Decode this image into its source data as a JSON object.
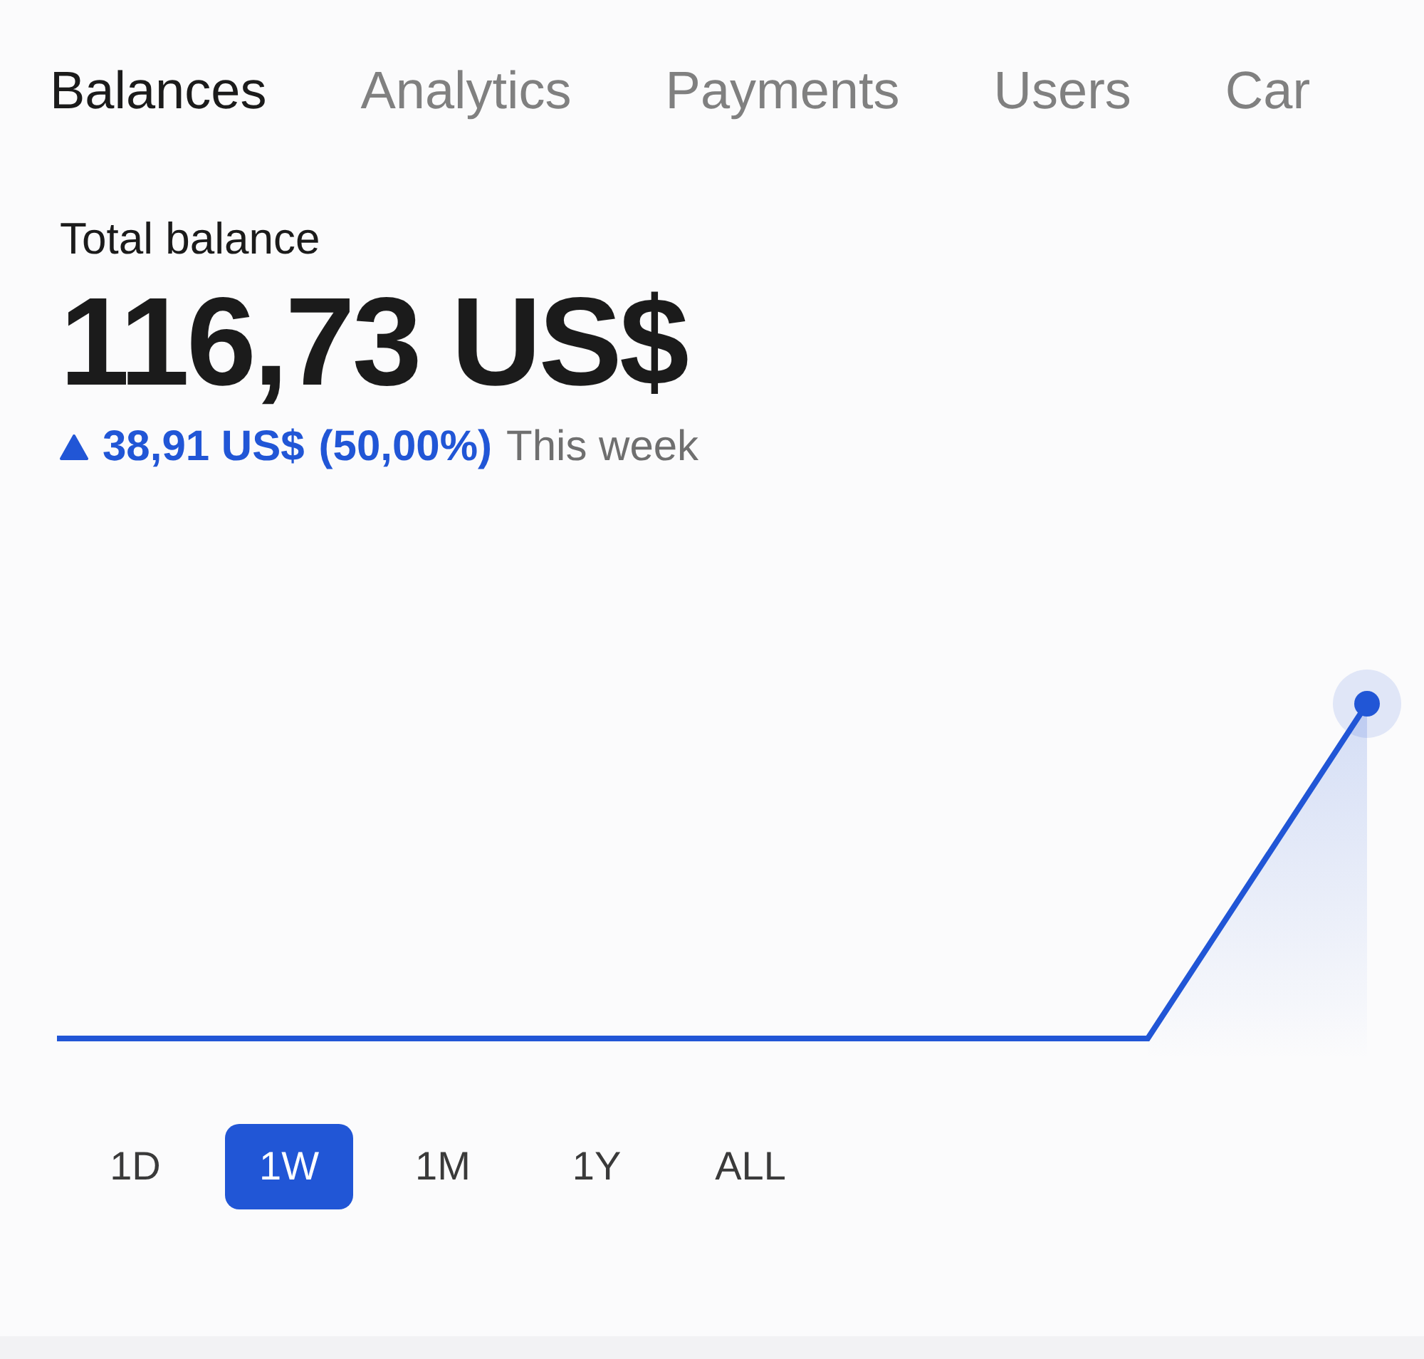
{
  "tabs": [
    {
      "label": "Balances",
      "selected": true
    },
    {
      "label": "Analytics",
      "selected": false
    },
    {
      "label": "Payments",
      "selected": false
    },
    {
      "label": "Users",
      "selected": false
    },
    {
      "label": "Car",
      "selected": false
    }
  ],
  "balance": {
    "label": "Total balance",
    "amount": "116,73 US$",
    "change": {
      "rising": true,
      "amount": "38,91 US$",
      "percent": "(50,00%)",
      "period": "This week"
    }
  },
  "ranges": [
    {
      "label": "1D",
      "selected": false
    },
    {
      "label": "1W",
      "selected": true
    },
    {
      "label": "1M",
      "selected": false
    },
    {
      "label": "1Y",
      "selected": false
    },
    {
      "label": "ALL",
      "selected": false
    }
  ]
}
